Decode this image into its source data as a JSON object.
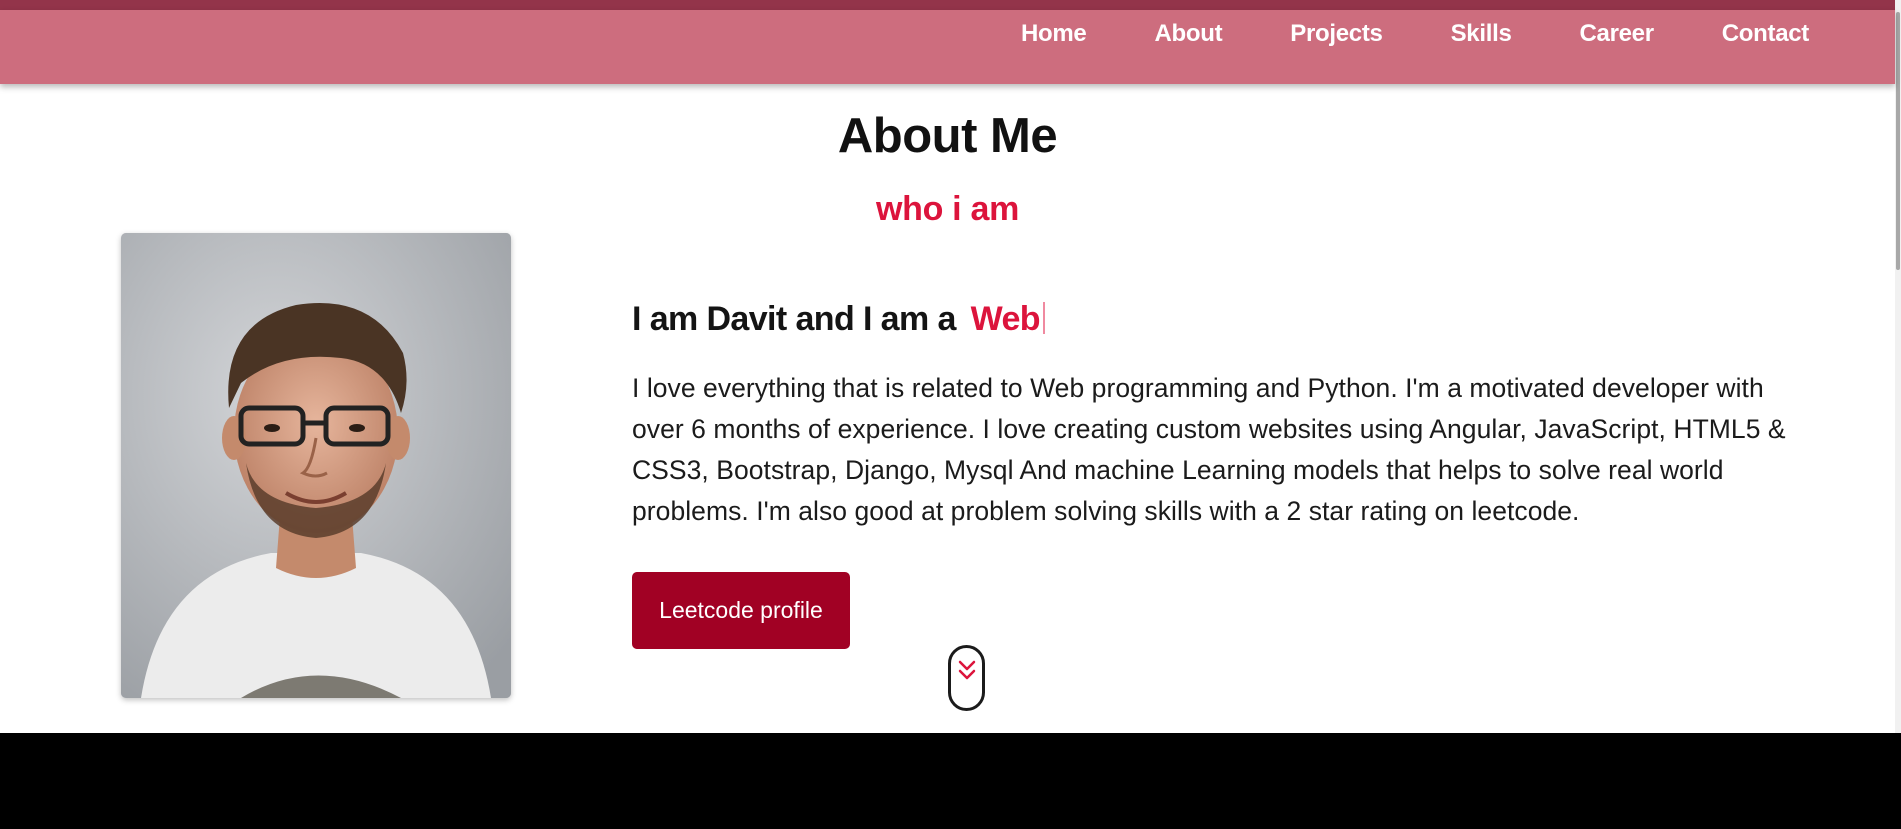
{
  "nav": {
    "links": [
      "Home",
      "About",
      "Projects",
      "Skills",
      "Career",
      "Contact"
    ]
  },
  "about": {
    "title": "About Me",
    "subtitle": "who i am",
    "intro_prefix": "I am Davit and I am a",
    "typed_word": "Web",
    "bio": "I love everything that is related to Web programming and Python. I'm a motivated developer with over 6 months of experience. I love creating custom websites using Angular, JavaScript, HTML5 & CSS3, Bootstrap, Django, Mysql And machine Learning models that helps to solve real world problems. I'm also good at problem solving skills with a 2 star rating on leetcode.",
    "button_label": "Leetcode profile",
    "photo_icon": "profile-photo",
    "scroll_icon": "chevron-double-down-icon"
  },
  "colors": {
    "nav_bg": "#cd6d7e",
    "nav_top": "#93344a",
    "accent": "#dc143c",
    "button": "#a10124",
    "footer": "#000000"
  }
}
